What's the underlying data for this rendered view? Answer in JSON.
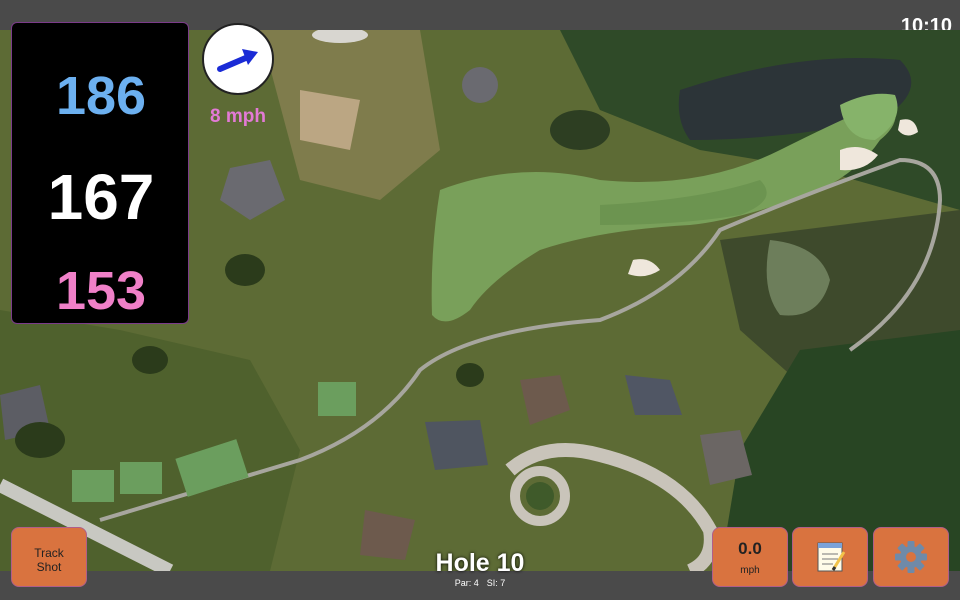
{
  "status": {
    "time": "10:10"
  },
  "distances": {
    "back": "186",
    "middle": "167",
    "front": "153"
  },
  "wind": {
    "speed_label": "8 mph",
    "direction_icon": "arrow-icon"
  },
  "buttons": {
    "track_shot_line1": "Track",
    "track_shot_line2": "Shot",
    "speed_value": "0.0",
    "speed_unit": "mph",
    "notes_icon": "notepad-icon",
    "settings_icon": "gear-icon"
  },
  "hole": {
    "title": "Hole 10",
    "par": "Par: 4",
    "si": "SI: 7"
  },
  "colors": {
    "back_distance": "#6cb0f0",
    "middle_distance": "#ffffff",
    "front_distance": "#f080c8",
    "wind_text": "#e37ad6",
    "button": "#d9733f"
  }
}
